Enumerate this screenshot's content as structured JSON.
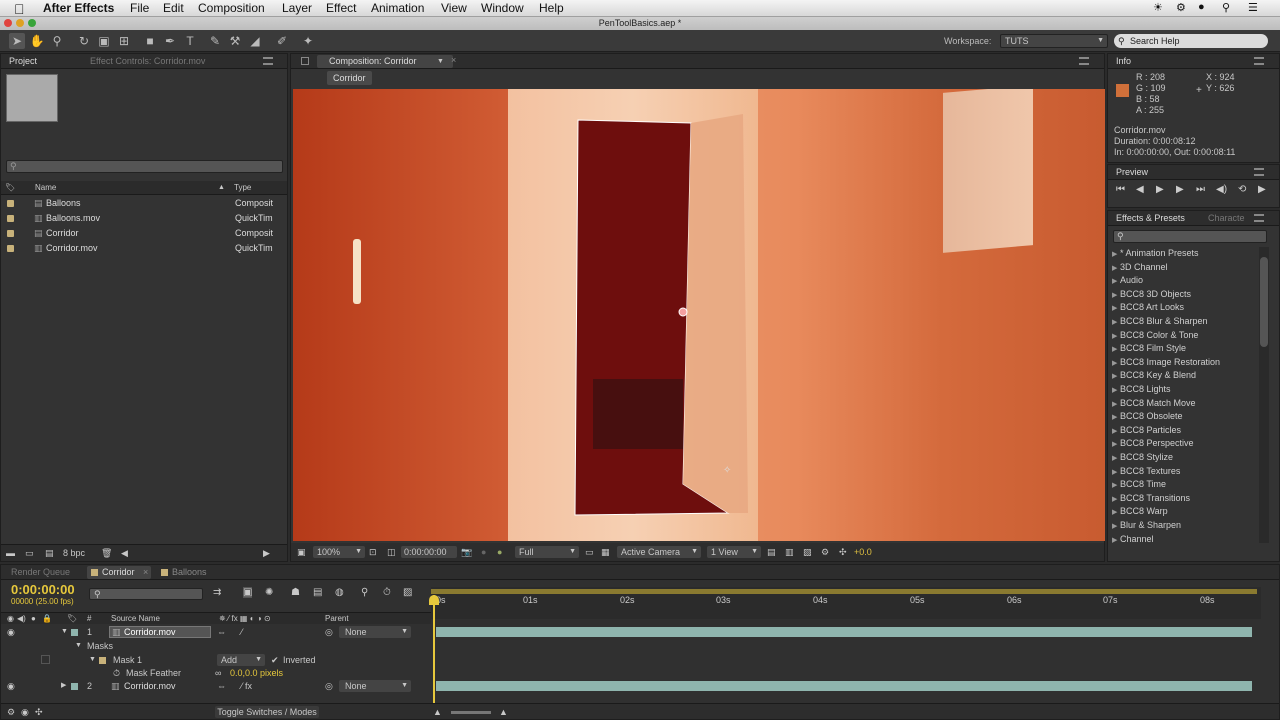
{
  "menubar": {
    "app": "After Effects",
    "items": [
      "File",
      "Edit",
      "Composition",
      "Layer",
      "Effect",
      "Animation",
      "View",
      "Window",
      "Help"
    ]
  },
  "titlebar": {
    "title": "PenToolBasics.aep *"
  },
  "toolbar": {
    "workspace_label": "Workspace:",
    "workspace_value": "TUTS",
    "search_placeholder": "Search Help"
  },
  "project": {
    "tab": "Project",
    "effect_tab": "Effect Controls: Corridor.mov",
    "search_placeholder": "",
    "col_name": "Name",
    "col_type": "Type",
    "items": [
      {
        "name": "Balloons",
        "type": "Composit"
      },
      {
        "name": "Balloons.mov",
        "type": "QuickTim"
      },
      {
        "name": "Corridor",
        "type": "Composit"
      },
      {
        "name": "Corridor.mov",
        "type": "QuickTim"
      }
    ],
    "bpc": "8 bpc"
  },
  "composition": {
    "tab": "Composition: Corridor",
    "crumb": "Corridor",
    "zoom": "100%",
    "time": "0:00:00:00",
    "resolution": "Full",
    "camera": "Active Camera",
    "view": "1 View",
    "exposure": "+0.0"
  },
  "info": {
    "tab": "Info",
    "r": "R : 208",
    "g": "G : 109",
    "b": "B : 58",
    "a": "A : 255",
    "x": "X : 924",
    "y": "Y : 626",
    "file": "Corridor.mov",
    "duration": "Duration: 0:00:08:12",
    "inout": "In: 0:00:00:00, Out: 0:00:08:11",
    "swatch": "#d0703a"
  },
  "preview": {
    "tab": "Preview"
  },
  "effects": {
    "tab": "Effects & Presets",
    "tab2": "Characte",
    "search_placeholder": "",
    "items": [
      "* Animation Presets",
      "3D Channel",
      "Audio",
      "BCC8 3D Objects",
      "BCC8 Art Looks",
      "BCC8 Blur & Sharpen",
      "BCC8 Color & Tone",
      "BCC8 Film Style",
      "BCC8 Image Restoration",
      "BCC8 Key & Blend",
      "BCC8 Lights",
      "BCC8 Match Move",
      "BCC8 Obsolete",
      "BCC8 Particles",
      "BCC8 Perspective",
      "BCC8 Stylize",
      "BCC8 Textures",
      "BCC8 Time",
      "BCC8 Transitions",
      "BCC8 Warp",
      "Blur & Sharpen",
      "Channel"
    ]
  },
  "timeline": {
    "tabs": [
      "Render Queue",
      "Corridor",
      "Balloons"
    ],
    "timecode": "0:00:00:00",
    "frames": "00000 (25.00 fps)",
    "col_source": "Source Name",
    "col_parent": "Parent",
    "rulers": [
      "0s",
      "01s",
      "02s",
      "03s",
      "04s",
      "05s",
      "06s",
      "07s",
      "08s"
    ],
    "layer1": {
      "num": "1",
      "name": "Corridor.mov",
      "parent": "None"
    },
    "masks_label": "Masks",
    "mask1": "Mask 1",
    "mask_mode": "Add",
    "inverted": "Inverted",
    "feather_label": "Mask Feather",
    "feather_value": "0.0,0.0 pixels",
    "layer2": {
      "num": "2",
      "name": "Corridor.mov",
      "parent": "None"
    },
    "toggle": "Toggle Switches / Modes"
  }
}
